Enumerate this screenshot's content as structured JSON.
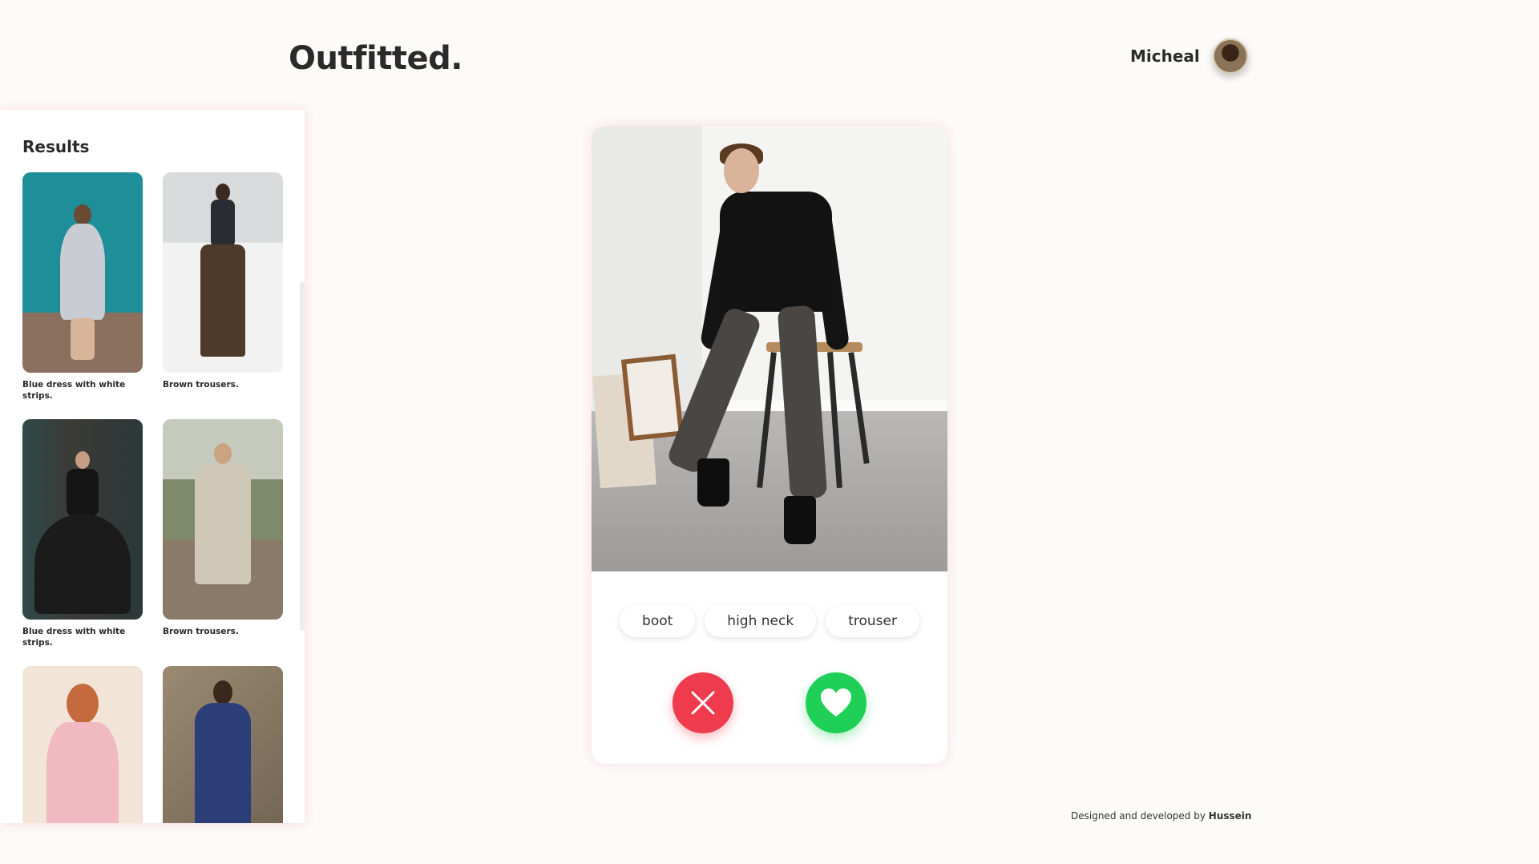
{
  "header": {
    "brand": "Outfitted.",
    "user_name": "Micheal"
  },
  "sidebar": {
    "title": "Results",
    "results": [
      {
        "caption": "Blue dress with white strips.",
        "bg": "#1f8a94"
      },
      {
        "caption": "Brown trousers.",
        "bg": "#e9eaea"
      },
      {
        "caption": "Blue dress with white strips.",
        "bg": "#3b3f3c"
      },
      {
        "caption": "Brown trousers.",
        "bg": "#8f9a88"
      },
      {
        "caption": "",
        "bg": "#f1e4d6"
      },
      {
        "caption": "",
        "bg": "#8a7a66"
      }
    ]
  },
  "card": {
    "tags": [
      "boot",
      "high neck",
      "trouser"
    ],
    "reject_icon": "close-icon",
    "like_icon": "heart-icon"
  },
  "colors": {
    "reject": "#ef3b4d",
    "like": "#1fcf57",
    "background": "#fdfbfa"
  },
  "footer": {
    "prefix": "Designed and developed by",
    "author": "Hussein"
  }
}
